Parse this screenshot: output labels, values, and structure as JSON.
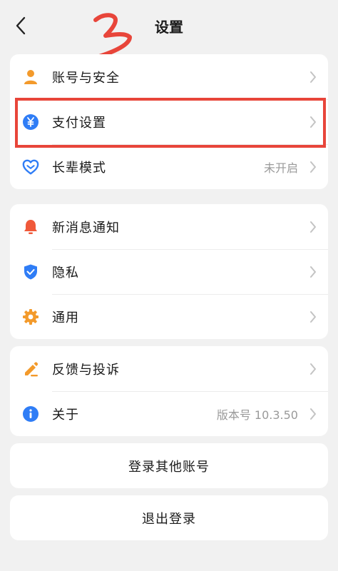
{
  "header": {
    "title": "设置"
  },
  "groups": [
    {
      "rows": [
        {
          "label": "账号与安全",
          "value": "",
          "icon": "account-icon"
        },
        {
          "label": "支付设置",
          "value": "",
          "icon": "yuan-icon"
        },
        {
          "label": "长辈模式",
          "value": "未开启",
          "icon": "elder-heart-icon"
        }
      ]
    },
    {
      "rows": [
        {
          "label": "新消息通知",
          "value": "",
          "icon": "bell-icon"
        },
        {
          "label": "隐私",
          "value": "",
          "icon": "shield-icon"
        },
        {
          "label": "通用",
          "value": "",
          "icon": "gear-icon"
        }
      ]
    },
    {
      "rows": [
        {
          "label": "反馈与投诉",
          "value": "",
          "icon": "pencil-icon"
        },
        {
          "label": "关于",
          "value": "版本号 10.3.50",
          "icon": "info-icon"
        }
      ]
    }
  ],
  "buttons": {
    "switch_account": "登录其他账号",
    "logout": "退出登录"
  },
  "colors": {
    "annotation_red": "#e8453a",
    "orange": "#f39a2b",
    "blue": "#2f7df6",
    "bell_red": "#f0593a"
  }
}
